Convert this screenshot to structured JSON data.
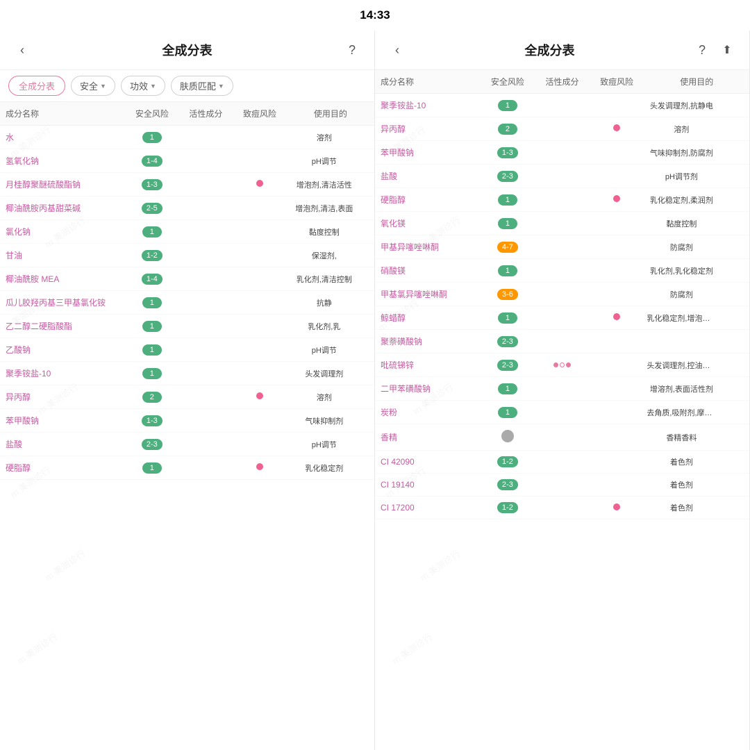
{
  "statusBar": {
    "time": "14:33"
  },
  "leftPanel": {
    "title": "全成分表",
    "backIcon": "‹",
    "helpIcon": "?",
    "tabs": [
      {
        "label": "全成分表",
        "active": true
      },
      {
        "label": "安全",
        "dropdown": true
      },
      {
        "label": "功效",
        "dropdown": true
      },
      {
        "label": "肤质匹配",
        "dropdown": true
      }
    ],
    "tableHeaders": [
      "成分名称",
      "安全风险",
      "活性成分",
      "致痘风险",
      "使用目的"
    ],
    "rows": [
      {
        "name": "水",
        "safety": "1",
        "safetyColor": "green",
        "active": "",
        "acne": false,
        "use": "溶剂"
      },
      {
        "name": "氢氧化钠",
        "safety": "1-4",
        "safetyColor": "green",
        "active": "",
        "acne": false,
        "use": "pH调节"
      },
      {
        "name": "月桂醇聚醚硫酸酯钠",
        "safety": "1-3",
        "safetyColor": "green",
        "active": "",
        "acne": true,
        "use": "增泡剂,清洁活性"
      },
      {
        "name": "椰油酰胺丙基甜菜碱",
        "safety": "2-5",
        "safetyColor": "green",
        "active": "",
        "acne": false,
        "use": "增泡剂,清洁,表面"
      },
      {
        "name": "氯化钠",
        "safety": "1",
        "safetyColor": "green",
        "active": "",
        "acne": false,
        "use": "黏度控制"
      },
      {
        "name": "甘油",
        "safety": "1-2",
        "safetyColor": "green",
        "active": "",
        "acne": false,
        "use": "保湿剂,"
      },
      {
        "name": "椰油酰胺 MEA",
        "safety": "1-4",
        "safetyColor": "green",
        "active": "",
        "acne": false,
        "use": "乳化剂,清洁控制"
      },
      {
        "name": "瓜儿胶羟丙基三甲基氯化铵",
        "safety": "1",
        "safetyColor": "green",
        "active": "",
        "acne": false,
        "use": "抗静"
      },
      {
        "name": "乙二醇二硬脂酸酯",
        "safety": "1",
        "safetyColor": "green",
        "active": "",
        "acne": false,
        "use": "乳化剂,乳"
      },
      {
        "name": "乙酸钠",
        "safety": "1",
        "safetyColor": "green",
        "active": "",
        "acne": false,
        "use": "pH调节"
      },
      {
        "name": "聚季铵盐-10",
        "safety": "1",
        "safetyColor": "green",
        "active": "",
        "acne": false,
        "use": "头发调理剂"
      },
      {
        "name": "异丙醇",
        "safety": "2",
        "safetyColor": "green",
        "active": "",
        "acne": true,
        "use": "溶剂"
      },
      {
        "name": "苯甲酸钠",
        "safety": "1-3",
        "safetyColor": "green",
        "active": "",
        "acne": false,
        "use": "气味抑制剂"
      },
      {
        "name": "盐酸",
        "safety": "2-3",
        "safetyColor": "green",
        "active": "",
        "acne": false,
        "use": "pH调节"
      },
      {
        "name": "硬脂醇",
        "safety": "1",
        "safetyColor": "green",
        "active": "",
        "acne": true,
        "use": "乳化稳定剂"
      }
    ]
  },
  "rightPanel": {
    "title": "全成分表",
    "backIcon": "‹",
    "helpIcon": "?",
    "shareIcon": "⬆",
    "tableHeaders": [
      "成分名称",
      "安全风险",
      "活性成分",
      "致痘风险",
      "使用目的"
    ],
    "rows": [
      {
        "name": "聚季铵盐-10",
        "safety": "1",
        "safetyColor": "green",
        "active": "",
        "acne": false,
        "use": "头发调理剂,抗静电"
      },
      {
        "name": "异丙醇",
        "safety": "2",
        "safetyColor": "green",
        "active": "",
        "acne": true,
        "use": "溶剂"
      },
      {
        "name": "苯甲酸钠",
        "safety": "1-3",
        "safetyColor": "green",
        "active": "",
        "acne": false,
        "use": "气味抑制剂,防腐剂"
      },
      {
        "name": "盐酸",
        "safety": "2-3",
        "safetyColor": "green",
        "active": "",
        "acne": false,
        "use": "pH调节剂"
      },
      {
        "name": "硬脂醇",
        "safety": "1",
        "safetyColor": "green",
        "active": "",
        "acne": true,
        "use": "乳化稳定剂,柔润剂"
      },
      {
        "name": "氧化镁",
        "safety": "1",
        "safetyColor": "green",
        "active": "",
        "acne": false,
        "use": "黏度控制"
      },
      {
        "name": "甲基异噻唑啉酮",
        "safety": "4-7",
        "safetyColor": "orange",
        "active": "",
        "acne": false,
        "use": "防腐剂"
      },
      {
        "name": "硝酸镁",
        "safety": "1",
        "safetyColor": "green",
        "active": "",
        "acne": false,
        "use": "乳化剂,乳化稳定剂"
      },
      {
        "name": "甲基氯异噻唑啉酮",
        "safety": "3-6",
        "safetyColor": "orange",
        "active": "",
        "acne": false,
        "use": "防腐剂"
      },
      {
        "name": "鲸蜡醇",
        "safety": "1",
        "safetyColor": "green",
        "active": "",
        "acne": true,
        "use": "乳化稳定剂,增泡剂,柔润剂"
      },
      {
        "name": "聚萘磺酸钠",
        "safety": "2-3",
        "safetyColor": "green",
        "active": "",
        "acne": false,
        "use": ""
      },
      {
        "name": "吡硫锑锌",
        "safety": "2-3",
        "safetyColor": "green",
        "active": "circles",
        "acne": false,
        "use": "头发调理剂,控油抗脂溢"
      },
      {
        "name": "二甲苯磺酸钠",
        "safety": "1",
        "safetyColor": "green",
        "active": "",
        "acne": false,
        "use": "增溶剂,表面活性剂"
      },
      {
        "name": "炭粉",
        "safety": "1",
        "safetyColor": "green",
        "active": "",
        "acne": false,
        "use": "去角质,吸附剂,摩擦剂"
      },
      {
        "name": "香精",
        "safety": "",
        "safetyColor": "gray",
        "active": "",
        "acne": false,
        "use": "香精香料"
      },
      {
        "name": "CI 42090",
        "safety": "1-2",
        "safetyColor": "green",
        "active": "",
        "acne": false,
        "use": "着色剂"
      },
      {
        "name": "CI 19140",
        "safety": "2-3",
        "safetyColor": "green",
        "active": "",
        "acne": false,
        "use": "着色剂"
      },
      {
        "name": "CI 17200",
        "safety": "1-2",
        "safetyColor": "green",
        "active": "",
        "acne": true,
        "use": "着色剂"
      }
    ]
  },
  "watermark": "美测诊行"
}
